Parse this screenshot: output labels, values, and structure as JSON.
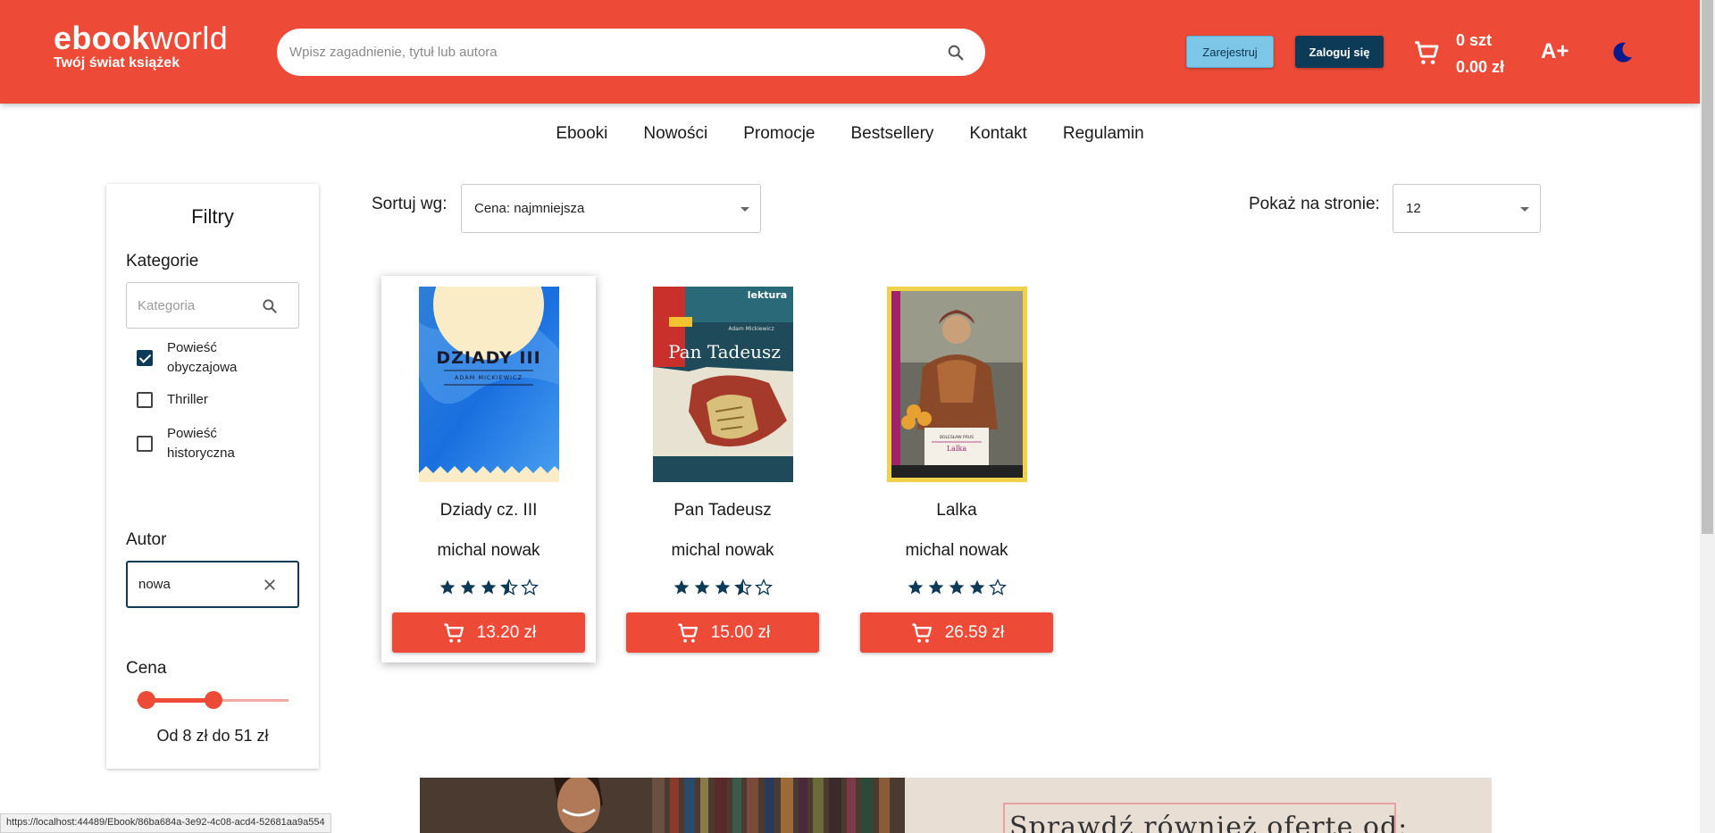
{
  "header": {
    "logo_bold": "ebook",
    "logo_light": "world",
    "logo_subtitle": "Twój świat książek",
    "search_placeholder": "Wpisz zagadnienie, tytuł lub autora",
    "register_label": "Zarejestruj",
    "login_label": "Zaloguj się",
    "cart_count": "0 szt",
    "cart_total": "0.00 zł",
    "font_size_label": "A+",
    "colors": {
      "primary": "#ed4b37",
      "navy": "#0d3a57",
      "light_blue": "#7cc6e8"
    }
  },
  "nav": {
    "items": [
      {
        "label": "Ebooki"
      },
      {
        "label": "Nowości"
      },
      {
        "label": "Promocje"
      },
      {
        "label": "Bestsellery"
      },
      {
        "label": "Kontakt"
      },
      {
        "label": "Regulamin"
      }
    ]
  },
  "filters": {
    "title": "Filtry",
    "categories_label": "Kategorie",
    "category_placeholder": "Kategoria",
    "categories": [
      {
        "label": "Powieść obyczajowa",
        "checked": true
      },
      {
        "label": "Thriller",
        "checked": false
      },
      {
        "label": "Powieść historyczna",
        "checked": false
      }
    ],
    "author_label": "Autor",
    "author_value": "nowa",
    "price_label": "Cena",
    "price_min": 8,
    "price_max": 51,
    "price_range_text": "Od 8 zł do 51 zł"
  },
  "sorting": {
    "sort_label": "Sortuj wg:",
    "sort_value": "Cena: najmniejsza",
    "per_page_label": "Pokaż na stronie:",
    "per_page_value": "12"
  },
  "products": [
    {
      "title": "Dziady cz. III",
      "author": "michal nowak",
      "rating": 3.5,
      "price": "13.20 zł",
      "cover": "dziady-cover",
      "cover_title": "DZIADY III",
      "cover_author": "ADAM MICKIEWICZ"
    },
    {
      "title": "Pan Tadeusz",
      "author": "michal nowak",
      "rating": 3.5,
      "price": "15.00 zł",
      "cover": "pan-tadeusz-cover",
      "cover_title": "Pan Tadeusz",
      "cover_series": "lektura",
      "cover_author": "Adam Mickiewicz"
    },
    {
      "title": "Lalka",
      "author": "michal nowak",
      "rating": 4,
      "price": "26.59 zł",
      "cover": "lalka-cover",
      "cover_title": "Lalka",
      "cover_author": "BOLESŁAW PRUS"
    }
  ],
  "banner": {
    "text": "Sprawdź również ofertę od:"
  },
  "status_bar": {
    "url": "https://localhost:44489/Ebook/86ba684a-3e92-4c08-acd4-52681aa9a554"
  }
}
